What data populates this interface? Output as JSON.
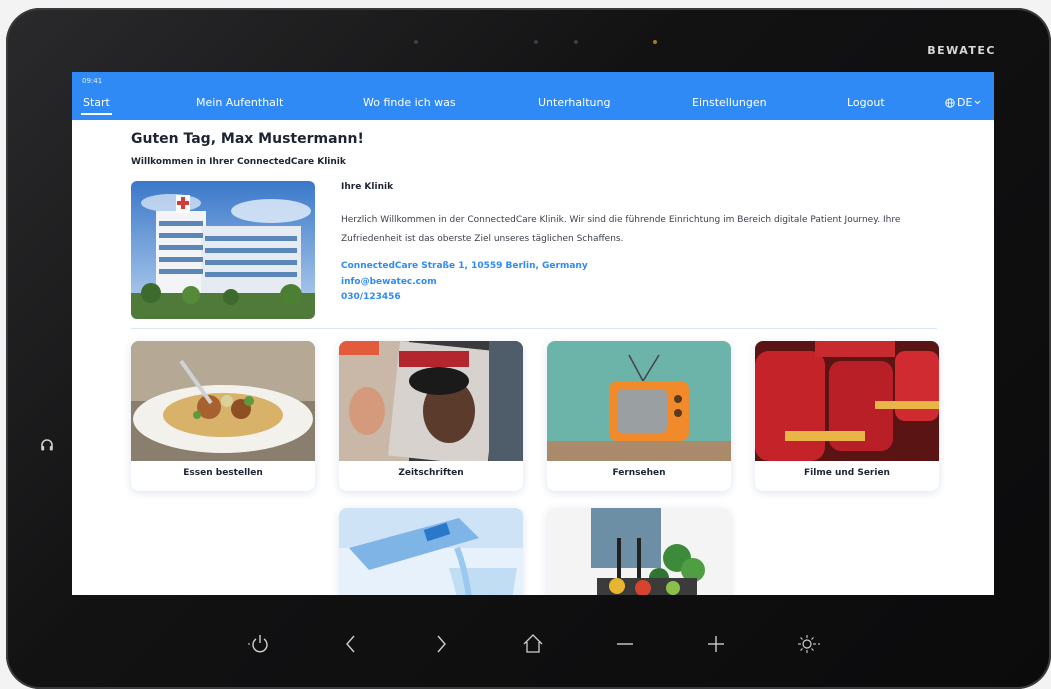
{
  "device": {
    "brand": "BEWATEC"
  },
  "status": {
    "time": "09:41"
  },
  "nav": {
    "items": [
      "Start",
      "Mein Aufenthalt",
      "Wo finde ich was",
      "Unterhaltung",
      "Einstellungen",
      "Logout"
    ],
    "language": "DE",
    "active_item": "Start"
  },
  "main": {
    "greeting": "Guten Tag, Max Mustermann!",
    "welcome": "Willkommen in Ihrer ConnectedCare Klinik",
    "clinic": {
      "title": "Ihre Klinik",
      "description": "Herzlich Willkommen in der ConnectedCare Klinik. Wir sind die führende Einrichtung im Bereich digitale Patient Journey. Ihre Zufriedenheit ist das oberste Ziel unseres täglichen Schaffens.",
      "address": "ConnectedCare Straße 1, 10559 Berlin, Germany",
      "email": "info@bewatec.com",
      "phone": "030/123456"
    },
    "tiles": [
      {
        "label": "Essen bestellen"
      },
      {
        "label": "Zeitschriften"
      },
      {
        "label": "Fernsehen"
      },
      {
        "label": "Filme und Serien"
      },
      {
        "label": ""
      },
      {
        "label": ""
      }
    ]
  },
  "hardware_buttons": [
    "power-icon",
    "back-icon",
    "forward-icon",
    "home-icon",
    "volume-down-icon",
    "volume-up-icon",
    "brightness-icon"
  ],
  "colors": {
    "accent": "#2f8af5",
    "link": "#2f8af5",
    "text": "#1d2433",
    "bezel": "#121213"
  }
}
